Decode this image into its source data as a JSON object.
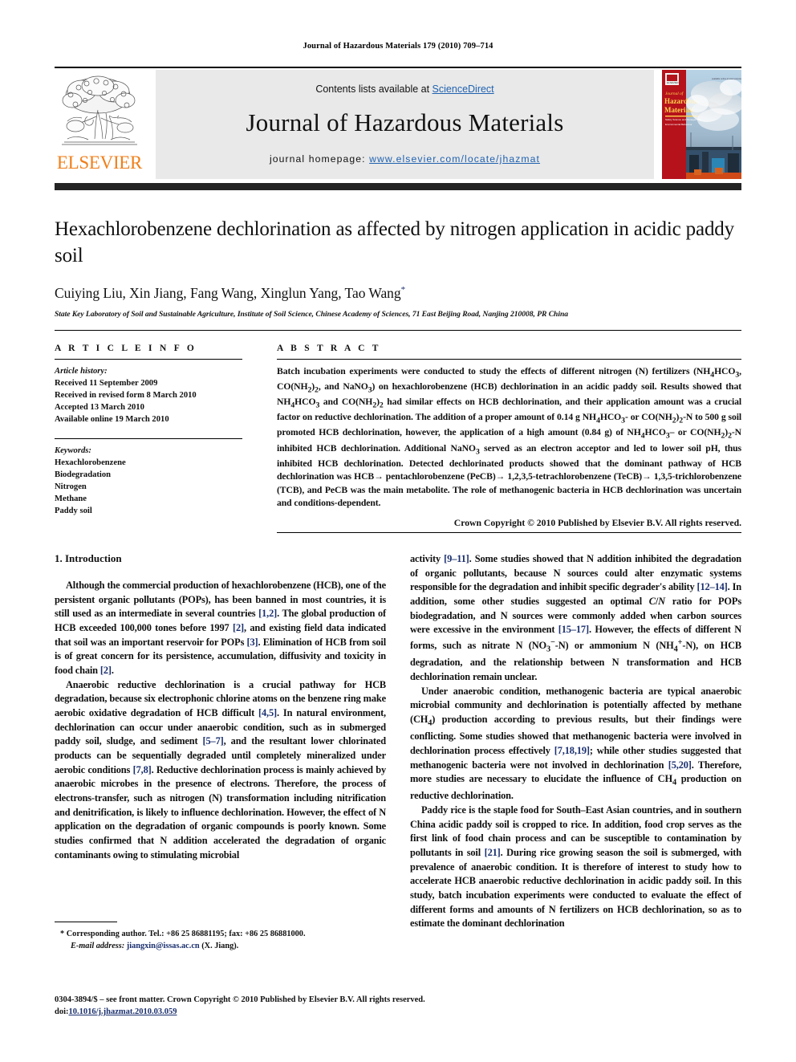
{
  "running_head": "Journal of Hazardous Materials 179 (2010) 709–714",
  "masthead": {
    "contents_prefix": "Contents lists available at ",
    "contents_link": "ScienceDirect",
    "journal_title": "Journal of Hazardous Materials",
    "homepage_prefix": "journal homepage: ",
    "homepage_url": "www.elsevier.com/locate/jhazmat",
    "publisher_wordmark": "ELSEVIER",
    "cover": {
      "line1": "Journal of",
      "line2": "Hazardous",
      "line3": "Materials",
      "sub1": "Safety Science and Management",
      "sub2": "Environmental Behaviour"
    }
  },
  "title": "Hexachlorobenzene dechlorination as affected by nitrogen application in acidic paddy soil",
  "authors": "Cuiying Liu, Xin Jiang, Fang Wang, Xinglun Yang, Tao Wang",
  "author_marker": "*",
  "affiliation": "State Key Laboratory of Soil and Sustainable Agriculture, Institute of Soil Science, Chinese Academy of Sciences, 71 East Beijing Road, Nanjing 210008, PR China",
  "article_info": {
    "heading": "A R T I C L E  I N F O",
    "history_label": "Article history:",
    "history": [
      "Received 11 September 2009",
      "Received in revised form 8 March 2010",
      "Accepted 13 March 2010",
      "Available online 19 March 2010"
    ],
    "keywords_label": "Keywords:",
    "keywords": [
      "Hexachlorobenzene",
      "Biodegradation",
      "Nitrogen",
      "Methane",
      "Paddy soil"
    ]
  },
  "abstract": {
    "heading": "A B S T R A C T",
    "text": "Batch incubation experiments were conducted to study the effects of different nitrogen (N) fertilizers (NH4HCO3, CO(NH2)2, and NaNO3) on hexachlorobenzene (HCB) dechlorination in an acidic paddy soil. Results showed that NH4HCO3 and CO(NH2)2 had similar effects on HCB dechlorination, and their application amount was a crucial factor on reductive dechlorination. The addition of a proper amount of 0.14 g NH4HCO3- or CO(NH2)2-N to 500 g soil promoted HCB dechlorination, however, the application of a high amount (0.84 g) of NH4HCO3- or CO(NH2)2-N inhibited HCB dechlorination. Additional NaNO3 served as an electron acceptor and led to lower soil pH, thus inhibited HCB dechlorination. Detected dechlorinated products showed that the dominant pathway of HCB dechlorination was HCB→ pentachlorobenzene (PeCB)→ 1,2,3,5-tetrachlorobenzene (TeCB)→ 1,3,5-trichlorobenzene (TCB), and PeCB was the main metabolite. The role of methanogenic bacteria in HCB dechlorination was uncertain and conditions-dependent.",
    "copyright": "Crown Copyright © 2010 Published by Elsevier B.V. All rights reserved."
  },
  "introduction": {
    "heading": "1.  Introduction",
    "left_paragraphs": [
      "Although the commercial production of hexachlorobenzene (HCB), one of the persistent organic pollutants (POPs), has been banned in most countries, it is still used as an intermediate in several countries [1,2]. The global production of HCB exceeded 100,000 tones before 1997 [2], and existing field data indicated that soil was an important reservoir for POPs [3]. Elimination of HCB from soil is of great concern for its persistence, accumulation, diffusivity and toxicity in food chain [2].",
      "Anaerobic reductive dechlorination is a crucial pathway for HCB degradation, because six electrophonic chlorine atoms on the benzene ring make aerobic oxidative degradation of HCB difficult [4,5]. In natural environment, dechlorination can occur under anaerobic condition, such as in submerged paddy soil, sludge, and sediment [5–7], and the resultant lower chlorinated products can be sequentially degraded until completely mineralized under aerobic conditions [7,8]. Reductive dechlorination process is mainly achieved by anaerobic microbes in the presence of electrons. Therefore, the process of electrons-transfer, such as nitrogen (N) transformation including nitrification and denitrification, is likely to influence dechlorination. However, the effect of N application on the degradation of organic compounds is poorly known. Some studies confirmed that N addition accelerated the degradation of organic contaminants owing to stimulating microbial"
    ],
    "right_paragraphs": [
      "activity [9–11]. Some studies showed that N addition inhibited the degradation of organic pollutants, because N sources could alter enzymatic systems responsible for the degradation and inhibit specific degrader's ability [12–14]. In addition, some other studies suggested an optimal C/N ratio for POPs biodegradation, and N sources were commonly added when carbon sources were excessive in the environment [15–17]. However, the effects of different N forms, such as nitrate N (NO3−-N) or ammonium N (NH4+-N), on HCB degradation, and the relationship between N transformation and HCB dechlorination remain unclear.",
      "Under anaerobic condition, methanogenic bacteria are typical anaerobic microbial community and dechlorination is potentially affected by methane (CH4) production according to previous results, but their findings were conflicting. Some studies showed that methanogenic bacteria were involved in dechlorination process effectively [7,18,19]; while other studies suggested that methanogenic bacteria were not involved in dechlorination [5,20]. Therefore, more studies are necessary to elucidate the influence of CH4 production on reductive dechlorination.",
      "Paddy rice is the staple food for South–East Asian countries, and in southern China acidic paddy soil is cropped to rice. In addition, food crop serves as the first link of food chain process and can be susceptible to contamination by pollutants in soil [21]. During rice growing season the soil is submerged, with prevalence of anaerobic condition. It is therefore of interest to study how to accelerate HCB anaerobic reductive dechlorination in acidic paddy soil. In this study, batch incubation experiments were conducted to evaluate the effect of different forms and amounts of N fertilizers on HCB dechlorination, so as to estimate the dominant dechlorination"
    ]
  },
  "footnote": {
    "marker": "*",
    "corresponding": "Corresponding author. Tel.: +86 25 86881195; fax: +86 25 86881000.",
    "email_label": "E-mail address:",
    "email": "jiangxin@issas.ac.cn",
    "email_owner": "(X. Jiang)."
  },
  "page_footer": {
    "line1": "0304-3894/$ – see front matter. Crown Copyright © 2010 Published by Elsevier B.V. All rights reserved.",
    "doi_label": "doi:",
    "doi": "10.1016/j.jhazmat.2010.03.059"
  },
  "colors": {
    "link": "#2062b0",
    "reference": "#1a2f6e",
    "elsevier_orange": "#F07F1A",
    "band_gray": "#e9e9e9",
    "rule_dark": "#242424"
  }
}
